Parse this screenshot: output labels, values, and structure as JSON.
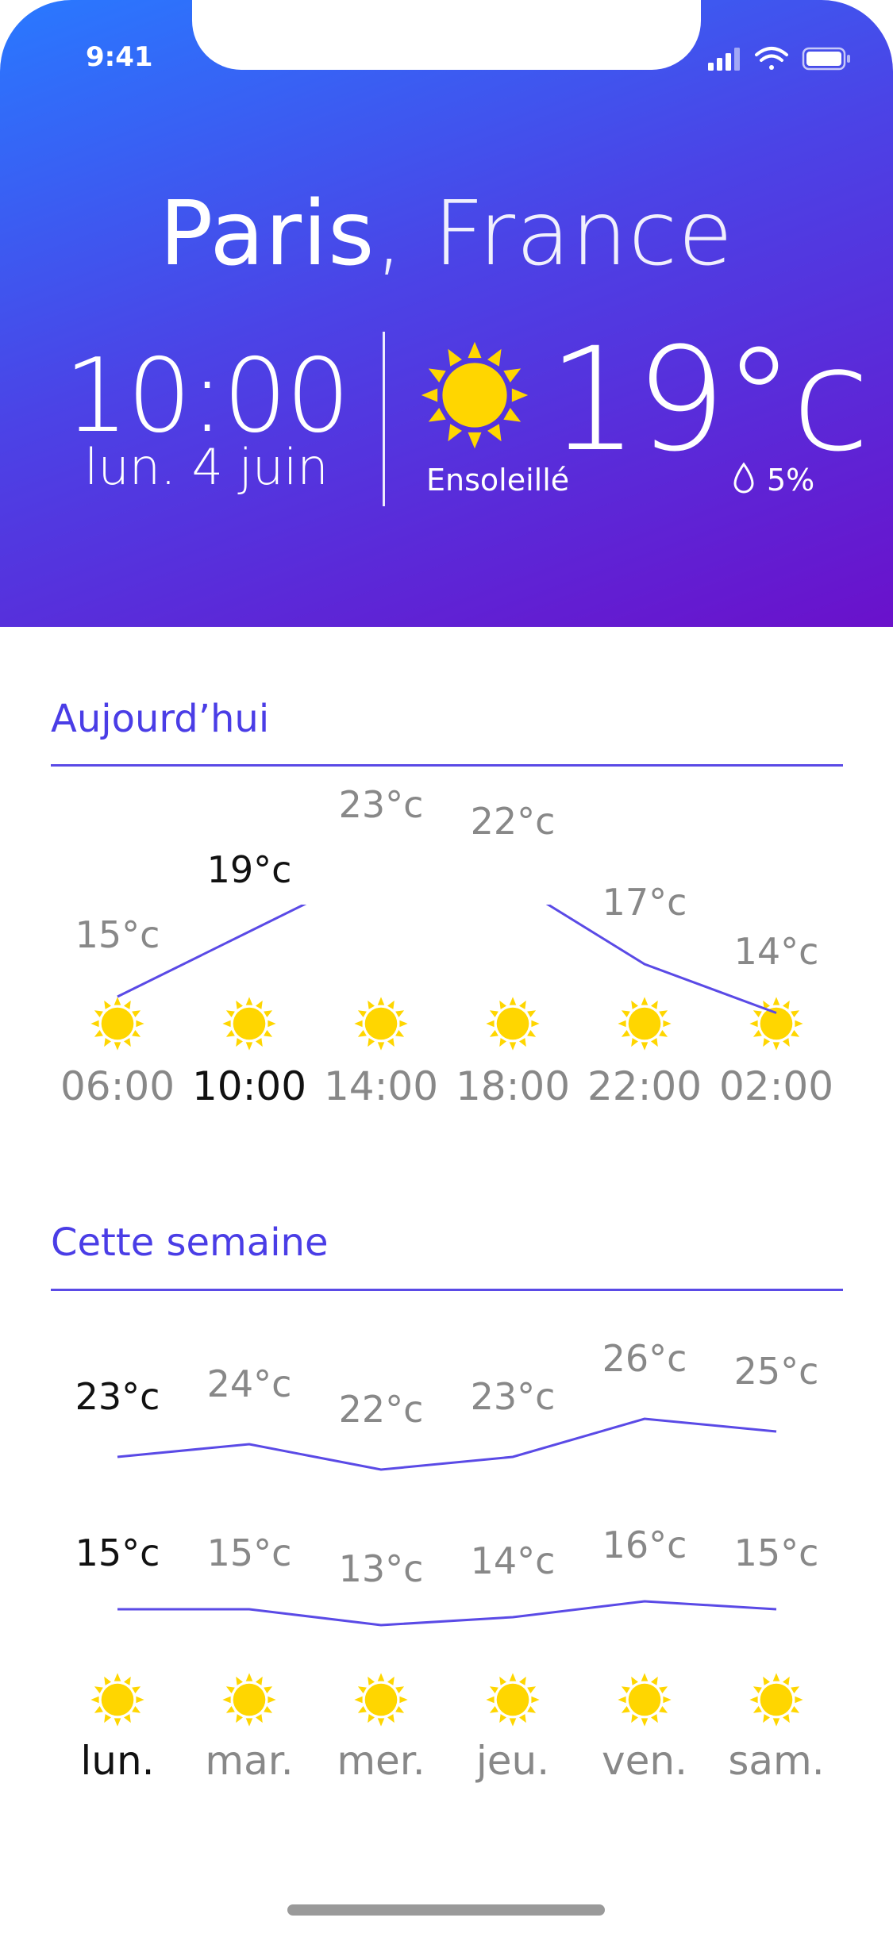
{
  "status_bar": {
    "time": "9:41",
    "icons": [
      "signal-icon",
      "wifi-icon",
      "battery-icon"
    ]
  },
  "header": {
    "city": "Paris",
    "country": ", France",
    "time": "10:00",
    "date": "lun. 4 juin",
    "temperature": "19°c",
    "condition": "Ensoleillé",
    "rain_chance": "5%",
    "condition_icon": "sun-icon",
    "rain_icon": "drop-icon",
    "gradient": [
      "#2979ff",
      "#6a11cb"
    ]
  },
  "today": {
    "title": "Aujourd’hui",
    "accent": "#4a3de6",
    "hours": [
      {
        "time": "06:00",
        "temp": "15°c",
        "value": 15,
        "active": false
      },
      {
        "time": "10:00",
        "temp": "19°c",
        "value": 19,
        "active": true
      },
      {
        "time": "14:00",
        "temp": "23°c",
        "value": 23,
        "active": false
      },
      {
        "time": "18:00",
        "temp": "22°c",
        "value": 22,
        "active": false
      },
      {
        "time": "22:00",
        "temp": "17°c",
        "value": 17,
        "active": false
      },
      {
        "time": "02:00",
        "temp": "14°c",
        "value": 14,
        "active": false
      }
    ]
  },
  "week": {
    "title": "Cette semaine",
    "days": [
      {
        "day": "lun.",
        "high": "23°c",
        "high_value": 23,
        "low": "15°c",
        "low_value": 15,
        "active": true
      },
      {
        "day": "mar.",
        "high": "24°c",
        "high_value": 24,
        "low": "15°c",
        "low_value": 15,
        "active": false
      },
      {
        "day": "mer.",
        "high": "22°c",
        "high_value": 22,
        "low": "13°c",
        "low_value": 13,
        "active": false
      },
      {
        "day": "jeu.",
        "high": "23°c",
        "high_value": 23,
        "low": "14°c",
        "low_value": 14,
        "active": false
      },
      {
        "day": "ven.",
        "high": "26°c",
        "high_value": 26,
        "low": "16°c",
        "low_value": 16,
        "active": false
      },
      {
        "day": "sam.",
        "high": "25°c",
        "high_value": 25,
        "low": "15°c",
        "low_value": 15,
        "active": false
      }
    ]
  },
  "colors": {
    "sun": "#ffd600",
    "line": "#5a4ae6",
    "active_text": "#111111",
    "muted_text": "#888888"
  }
}
